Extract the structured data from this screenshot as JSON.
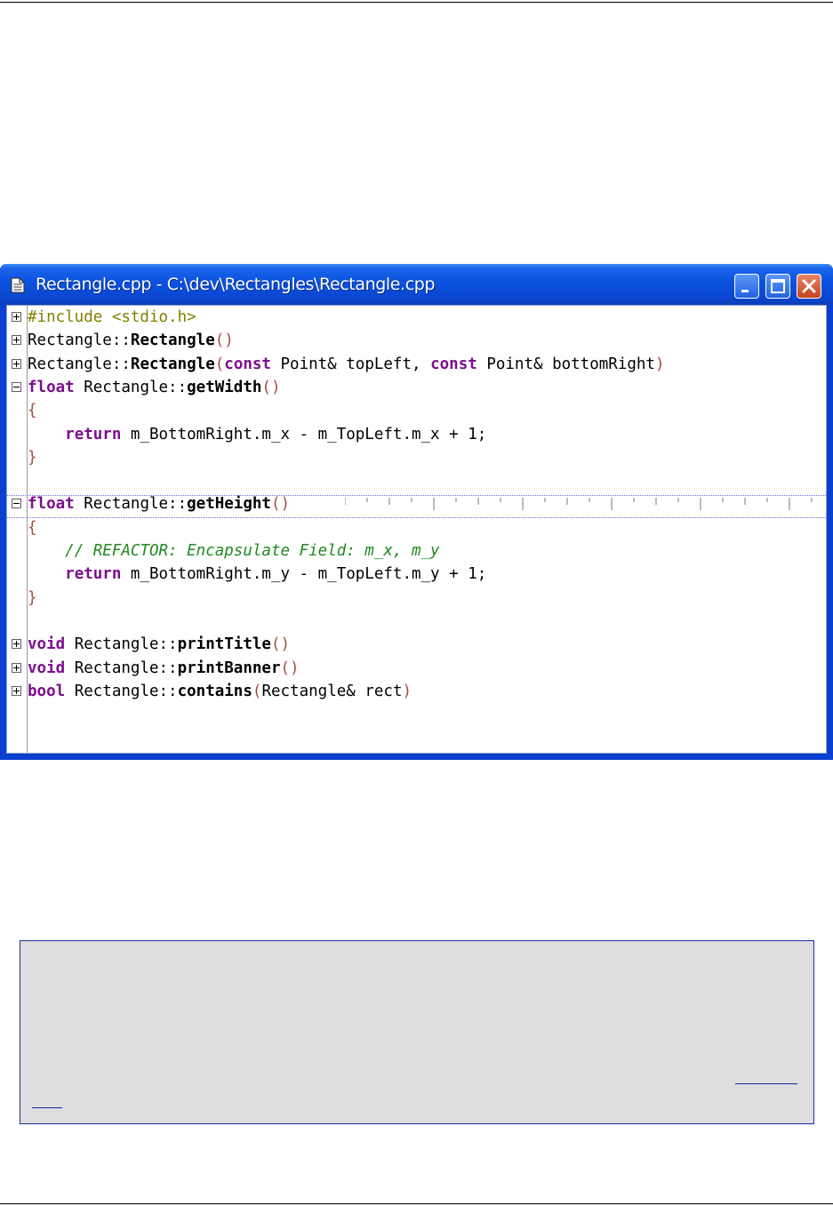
{
  "window": {
    "title": "Rectangle.cpp - C:\\dev\\Rectangles\\Rectangle.cpp",
    "buttons": [
      "minimize",
      "maximize",
      "close"
    ]
  },
  "editor": {
    "lines": [
      {
        "fold": "plus",
        "segments": [
          [
            "pp",
            "#include <stdio.h>"
          ]
        ]
      },
      {
        "fold": "plus",
        "segments": [
          [
            "",
            "Rectangle::"
          ],
          [
            "fn",
            "Rectangle"
          ],
          [
            "br",
            "()"
          ]
        ]
      },
      {
        "fold": "plus",
        "segments": [
          [
            "",
            "Rectangle::"
          ],
          [
            "fn",
            "Rectangle"
          ],
          [
            "br",
            "("
          ],
          [
            "kw",
            "const"
          ],
          [
            "",
            " Point& topLeft, "
          ],
          [
            "kw",
            "const"
          ],
          [
            "",
            " Point& bottomRight"
          ],
          [
            "br",
            ")"
          ]
        ]
      },
      {
        "fold": "minus",
        "segments": [
          [
            "kw",
            "float"
          ],
          [
            "",
            " Rectangle::"
          ],
          [
            "fn",
            "getWidth"
          ],
          [
            "br",
            "()"
          ]
        ]
      },
      {
        "fold": "",
        "segments": [
          [
            "br",
            "{"
          ]
        ]
      },
      {
        "fold": "",
        "segments": [
          [
            "",
            "    "
          ],
          [
            "kw",
            "return"
          ],
          [
            "",
            " m_BottomRight.m_x - m_TopLeft.m_x + 1;"
          ]
        ]
      },
      {
        "fold": "",
        "segments": [
          [
            "br",
            "}"
          ]
        ]
      },
      {
        "fold": "",
        "segments": []
      },
      {
        "fold": "minus",
        "segments": [
          [
            "kw",
            "float"
          ],
          [
            "",
            " Rectangle::"
          ],
          [
            "fn",
            "getHeight"
          ],
          [
            "br",
            "()"
          ]
        ]
      },
      {
        "fold": "",
        "segments": [
          [
            "br",
            "{"
          ]
        ]
      },
      {
        "fold": "",
        "segments": [
          [
            "",
            "    "
          ],
          [
            "cm",
            "// REFACTOR: Encapsulate Field: m_x, m_y"
          ]
        ]
      },
      {
        "fold": "",
        "segments": [
          [
            "",
            "    "
          ],
          [
            "kw",
            "return"
          ],
          [
            "",
            " m_BottomRight.m_y - m_TopLeft.m_y + 1;"
          ]
        ]
      },
      {
        "fold": "",
        "segments": [
          [
            "br",
            "}"
          ]
        ]
      },
      {
        "fold": "",
        "segments": []
      },
      {
        "fold": "plus",
        "segments": [
          [
            "kw",
            "void"
          ],
          [
            "",
            " Rectangle::"
          ],
          [
            "fn",
            "printTitle"
          ],
          [
            "br",
            "()"
          ]
        ]
      },
      {
        "fold": "plus",
        "segments": [
          [
            "kw",
            "void"
          ],
          [
            "",
            " Rectangle::"
          ],
          [
            "fn",
            "printBanner"
          ],
          [
            "br",
            "()"
          ]
        ]
      },
      {
        "fold": "plus",
        "segments": [
          [
            "kw",
            "bool"
          ],
          [
            "",
            " Rectangle::"
          ],
          [
            "fn",
            "contains"
          ],
          [
            "br",
            "("
          ],
          [
            "",
            "Rectangle& rect"
          ],
          [
            "br",
            ")"
          ]
        ]
      }
    ]
  },
  "colors": {
    "keyword": "#7a0f8c",
    "preprocessor": "#808000",
    "comment": "#1f8a1f",
    "brace": "#a05040",
    "titlebar": "#0a52de",
    "note_background": "#dedede"
  }
}
